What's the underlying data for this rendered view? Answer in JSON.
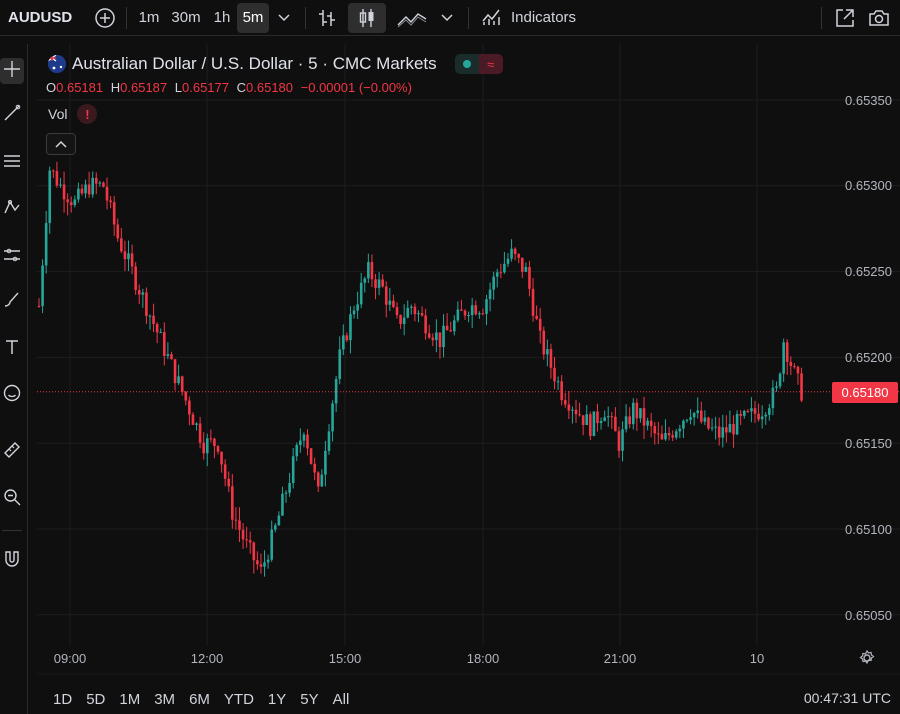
{
  "toolbar": {
    "symbol": "AUDUSD",
    "intervals": [
      "1m",
      "30m",
      "1h",
      "5m"
    ],
    "active_interval": "5m",
    "indicators_label": "Indicators"
  },
  "legend": {
    "title": "Australian Dollar / U.S. Dollar · 5 · CMC Markets",
    "open_label": "O",
    "open": "0.65181",
    "high_label": "H",
    "high": "0.65187",
    "low_label": "L",
    "low": "0.65177",
    "close_label": "C",
    "close": "0.65180",
    "change": "−0.00001 (−0.00%)",
    "vol_label": "Vol",
    "vol_warning": "!"
  },
  "price_axis": {
    "labels": [
      "0.65350",
      "0.65300",
      "0.65250",
      "0.65200",
      "0.65150",
      "0.65100",
      "0.65050"
    ],
    "last_price": "0.65180"
  },
  "time_axis": {
    "labels": [
      "09:00",
      "12:00",
      "15:00",
      "18:00",
      "21:00",
      "10"
    ]
  },
  "bottom": {
    "ranges": [
      "1D",
      "5D",
      "1M",
      "3M",
      "6M",
      "YTD",
      "1Y",
      "5Y",
      "All"
    ],
    "clock": "00:47:31 UTC"
  },
  "colors": {
    "up": "#26a69a",
    "down": "#f23645",
    "background": "#0f0f0f",
    "grid": "#1e1e1e"
  },
  "chart_data": {
    "type": "candlestick",
    "symbol": "AUDUSD",
    "interval": "5",
    "ylim": [
      0.65035,
      0.65375
    ],
    "x_tick_labels": [
      "09:00",
      "12:00",
      "15:00",
      "18:00",
      "21:00",
      "10"
    ],
    "y_tick_labels": [
      0.6535,
      0.653,
      0.6525,
      0.652,
      0.6515,
      0.651,
      0.6505
    ],
    "last_close": 0.6518,
    "path_anchors": [
      [
        0,
        0.6523
      ],
      [
        3,
        0.6531
      ],
      [
        6,
        0.653
      ],
      [
        10,
        0.6529
      ],
      [
        14,
        0.653
      ],
      [
        18,
        0.653
      ],
      [
        22,
        0.6527
      ],
      [
        28,
        0.6524
      ],
      [
        34,
        0.6521
      ],
      [
        40,
        0.6518
      ],
      [
        46,
        0.6515
      ],
      [
        50,
        0.6515
      ],
      [
        54,
        0.6511
      ],
      [
        58,
        0.6509
      ],
      [
        62,
        0.65075
      ],
      [
        66,
        0.651
      ],
      [
        70,
        0.6513
      ],
      [
        74,
        0.6516
      ],
      [
        78,
        0.6512
      ],
      [
        80,
        0.6515
      ],
      [
        84,
        0.652
      ],
      [
        88,
        0.6523
      ],
      [
        92,
        0.6525
      ],
      [
        96,
        0.6524
      ],
      [
        100,
        0.6522
      ],
      [
        104,
        0.6523
      ],
      [
        108,
        0.6522
      ],
      [
        112,
        0.6521
      ],
      [
        116,
        0.6522
      ],
      [
        120,
        0.6523
      ],
      [
        124,
        0.6523
      ],
      [
        128,
        0.6525
      ],
      [
        132,
        0.6526
      ],
      [
        136,
        0.6525
      ],
      [
        140,
        0.6521
      ],
      [
        146,
        0.6518
      ],
      [
        150,
        0.6517
      ],
      [
        154,
        0.6516
      ],
      [
        158,
        0.6517
      ],
      [
        162,
        0.6515
      ],
      [
        166,
        0.6517
      ],
      [
        170,
        0.6516
      ],
      [
        174,
        0.6515
      ],
      [
        178,
        0.6516
      ],
      [
        182,
        0.6517
      ],
      [
        186,
        0.6516
      ],
      [
        190,
        0.65155
      ],
      [
        194,
        0.6516
      ],
      [
        198,
        0.65165
      ],
      [
        202,
        0.6517
      ],
      [
        206,
        0.6518
      ],
      [
        208,
        0.6521
      ],
      [
        211,
        0.6519
      ],
      [
        213,
        0.6518
      ]
    ]
  }
}
